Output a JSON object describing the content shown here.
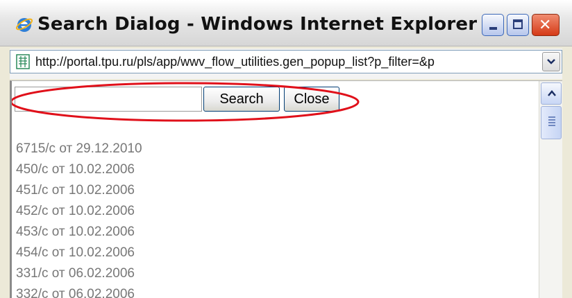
{
  "window": {
    "title": "Search Dialog - Windows Internet Explorer",
    "buttons": [
      "minimize",
      "maximize",
      "close"
    ]
  },
  "address_bar": {
    "url": "http://portal.tpu.ru/pls/app/wwv_flow_utilities.gen_popup_list?p_filter=&p"
  },
  "search": {
    "input_value": "",
    "search_label": "Search",
    "close_label": "Close"
  },
  "results": [
    "6715/с от 29.12.2010",
    "450/с от 10.02.2006",
    "451/с от 10.02.2006",
    "452/с от 10.02.2006",
    "453/с от 10.02.2006",
    "454/с от 10.02.2006",
    "331/с от 06.02.2006",
    "332/с от 06.02.2006"
  ],
  "colors": {
    "highlight": "#e0101a",
    "result_text": "#777777"
  },
  "icons": {
    "browser": "ie-icon",
    "page": "page-icon",
    "dropdown": "chevron-down-icon",
    "scroll_up": "arrow-up-icon"
  }
}
